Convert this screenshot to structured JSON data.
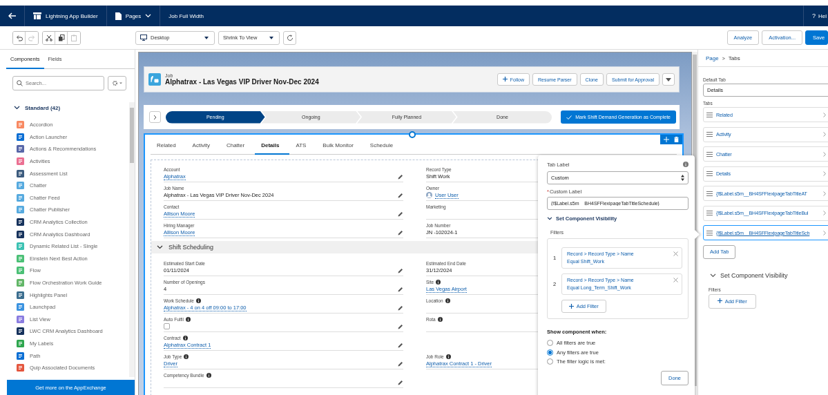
{
  "top_nav": {
    "app_title": "Lightning App Builder",
    "pages_menu": "Pages",
    "page_name": "Job Full Width",
    "help_mark": "?",
    "help": "Hel"
  },
  "toolbar": {
    "tools": [
      {
        "kind": "undo",
        "disabled": false
      },
      {
        "kind": "redo",
        "disabled": true
      },
      {
        "kind": "cut",
        "disabled": false
      },
      {
        "kind": "copy",
        "disabled": false
      },
      {
        "kind": "paste",
        "disabled": true
      }
    ],
    "device": "Desktop",
    "zoom": "Shrink To View",
    "actions": [
      {
        "label": "Analyze",
        "primary": false
      },
      {
        "label": "Activation...",
        "primary": false
      },
      {
        "label": "Save",
        "primary": true
      }
    ]
  },
  "left_panel": {
    "tabs": [
      {
        "label": "Components",
        "selected": true
      },
      {
        "label": "Fields",
        "selected": false
      }
    ],
    "search": {
      "placeholder": "Search..."
    },
    "group": {
      "label": "Standard (42)",
      "expanded": true,
      "items": [
        {
          "label": "Accordion",
          "color": "#f88962"
        },
        {
          "label": "Action Launcher",
          "color": "#0b6fd4"
        },
        {
          "label": "Actions & Recommendations",
          "color": "#5867a8"
        },
        {
          "label": "Activities",
          "color": "#eb7092"
        },
        {
          "label": "Assessment List",
          "color": "#3c5b7e"
        },
        {
          "label": "Chatter",
          "color": "#56aadf"
        },
        {
          "label": "Chatter Feed",
          "color": "#56aadf"
        },
        {
          "label": "Chatter Publisher",
          "color": "#56aadf"
        },
        {
          "label": "CRM Analytics Collection",
          "color": "#16325c"
        },
        {
          "label": "CRM Analytics Dashboard",
          "color": "#16325c"
        },
        {
          "label": "Dynamic Related List - Single",
          "color": "#3cc2b3"
        },
        {
          "label": "Einstein Next Best Action",
          "color": "#4bc076"
        },
        {
          "label": "Flow",
          "color": "#4bc076"
        },
        {
          "label": "Flow Orchestration Work Guide",
          "color": "#62b667"
        },
        {
          "label": "Highlights Panel",
          "color": "#3c6e8f"
        },
        {
          "label": "Launchpad",
          "color": "#3b93e0"
        },
        {
          "label": "List View",
          "color": "#8a7ce0"
        },
        {
          "label": "LWC CRM Analytics Dashboard",
          "color": "#16325c"
        },
        {
          "label": "My Labels",
          "color": "#2ea64e"
        },
        {
          "label": "Path",
          "color": "#0b6fd4"
        },
        {
          "label": "Quip Associated Documents",
          "color": "#e4563e"
        }
      ]
    },
    "footer": "Get more on the AppExchange"
  },
  "record": {
    "object": "Job",
    "title": "Alphatrax - Las Vegas VIP Driver Nov-Dec 2024",
    "follow": "Follow",
    "actions": [
      "Resume Parser",
      "Clone",
      "Submit for Approval"
    ],
    "path": [
      {
        "label": "Pending",
        "selected": true
      },
      {
        "label": "Ongoing",
        "selected": false
      },
      {
        "label": "Fully Planned",
        "selected": false
      },
      {
        "label": "Done",
        "selected": false
      }
    ],
    "mark_complete": "Mark Shift Demand Generation as Complete",
    "tabs": [
      {
        "label": "Related",
        "selected": false
      },
      {
        "label": "Activity",
        "selected": false
      },
      {
        "label": "Chatter",
        "selected": false
      },
      {
        "label": "Details",
        "selected": true
      },
      {
        "label": "ATS",
        "selected": false
      },
      {
        "label": "Bulk Monitor",
        "selected": false
      },
      {
        "label": "Schedule",
        "selected": false
      }
    ],
    "sections": [
      {
        "rows": [
          {
            "left": {
              "label": "Account",
              "info": false,
              "kind": "link",
              "value": "Alphatrax"
            },
            "right": {
              "label": "Record Type",
              "info": false,
              "kind": "text",
              "value": "Shift Work"
            }
          },
          {
            "left": {
              "label": "Job Name",
              "info": false,
              "kind": "text",
              "value": "Alphatrax - Las Vegas VIP Driver Nov-Dec 2024"
            },
            "right": {
              "label": "Owner",
              "info": false,
              "kind": "user",
              "value": "User User"
            }
          },
          {
            "left": {
              "label": "Contact",
              "info": false,
              "kind": "link",
              "value": "Allison Moore"
            },
            "right": {
              "label": "Marketing",
              "info": false,
              "kind": "empty"
            }
          },
          {
            "left": {
              "label": "Hiring Manager",
              "info": false,
              "kind": "link",
              "value": "Allison Moore"
            },
            "right": {
              "label": "Job Number",
              "info": false,
              "kind": "text",
              "value": "JN -102024-1"
            }
          }
        ]
      },
      {
        "title": "Shift Scheduling",
        "expanded": true,
        "rows": [
          {
            "left": {
              "label": "Estimated Start Date",
              "info": false,
              "kind": "text",
              "value": "01/11/2024"
            },
            "right": {
              "label": "Estimated End Date",
              "info": false,
              "kind": "text",
              "value": "31/12/2024"
            }
          },
          {
            "left": {
              "label": "Number of Openings",
              "info": false,
              "kind": "text",
              "value": "4"
            },
            "right": {
              "label": "Site",
              "info": true,
              "kind": "link",
              "value": "Las Vegas Airport"
            }
          },
          {
            "left": {
              "label": "Work Schedule",
              "info": true,
              "kind": "link",
              "value": "Alphatrax - 4 on 4 off 09:00 to 17:00"
            },
            "right": {
              "label": "Location",
              "info": true,
              "kind": "empty"
            }
          },
          {
            "left": {
              "label": "Auto Fulfil",
              "info": true,
              "kind": "checkbox",
              "checked": false
            },
            "right": {
              "label": "Rota",
              "info": true,
              "kind": "empty"
            }
          },
          {
            "left": {
              "label": "Contract",
              "info": true,
              "kind": "link",
              "value": "Alphatrax Contract 1"
            }
          },
          {
            "left": {
              "label": "Job Type",
              "info": true,
              "kind": "link",
              "value": "Driver"
            },
            "right": {
              "label": "Job Role",
              "info": true,
              "kind": "link",
              "value": "Alphatrax Contract 1 - Driver"
            }
          },
          {
            "left": {
              "label": "Competency Bundle",
              "info": true,
              "kind": "empty"
            }
          }
        ]
      }
    ]
  },
  "popover": {
    "tab_label": {
      "label": "Tab Label",
      "value": "Custom"
    },
    "custom_label": {
      "label": "Custom Label",
      "required_mark": "*",
      "value": "{!$Label.s5m__BH4SFFlexipageTabTitleSchedule}"
    },
    "visibility": {
      "title": "Set Component Visibility",
      "expanded": true,
      "filters_label": "Filters",
      "filters": [
        {
          "number": "1",
          "path": "Record > Record Type > Name",
          "condition": "Equal Shift_Work"
        },
        {
          "number": "2",
          "path": "Record > Record Type > Name",
          "condition": "Equal Long_Term_Shift_Work"
        }
      ],
      "add_filter": "Add Filter"
    },
    "show_when": {
      "label": "Show component when:",
      "options": [
        {
          "label": "All filters are true",
          "selected": false
        },
        {
          "label": "Any filters are true",
          "selected": true
        },
        {
          "label": "The filter logic is met:",
          "selected": false
        }
      ]
    },
    "done": "Done"
  },
  "properties": {
    "breadcrumb": {
      "parent": "Page",
      "separator": ">",
      "current": "Tabs"
    },
    "default_tab": {
      "label": "Default Tab",
      "value": "Details"
    },
    "tabs_label": "Tabs",
    "tabs": [
      {
        "label": "Related",
        "selected": false
      },
      {
        "label": "Activity",
        "selected": false
      },
      {
        "label": "Chatter",
        "selected": false
      },
      {
        "label": "Details",
        "selected": false
      },
      {
        "label": "{!$Label.s5m__BH4SFFlexipageTabTitleAT",
        "selected": false
      },
      {
        "label": "{!$Label.s5m__BH4SFFlexipageTabTitleBul",
        "selected": false
      },
      {
        "label": "{!$Label.s5m__BH4SFFlexipageTabTitleSch",
        "selected": true
      }
    ],
    "add_tab": "Add Tab",
    "visibility": {
      "title": "Set Component Visibility",
      "expanded": true,
      "filters_label": "Filters",
      "add_filter": "Add Filter"
    }
  }
}
